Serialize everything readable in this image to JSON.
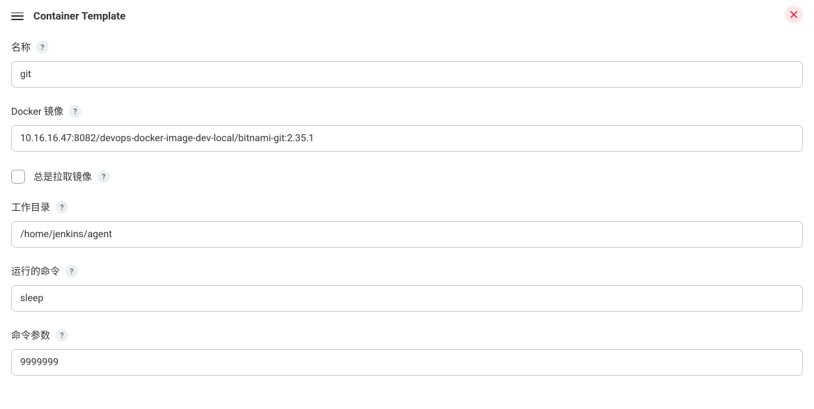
{
  "header": {
    "title": "Container Template"
  },
  "fields": {
    "name": {
      "label": "名称",
      "value": "git"
    },
    "dockerImage": {
      "label": "Docker 镜像",
      "value": "10.16.16.47:8082/devops-docker-image-dev-local/bitnami-git:2.35.1"
    },
    "alwaysPull": {
      "label": "总是拉取镜像"
    },
    "workDir": {
      "label": "工作目录",
      "value": "/home/jenkins/agent"
    },
    "command": {
      "label": "运行的命令",
      "value": "sleep"
    },
    "args": {
      "label": "命令参数",
      "value": "9999999"
    }
  }
}
